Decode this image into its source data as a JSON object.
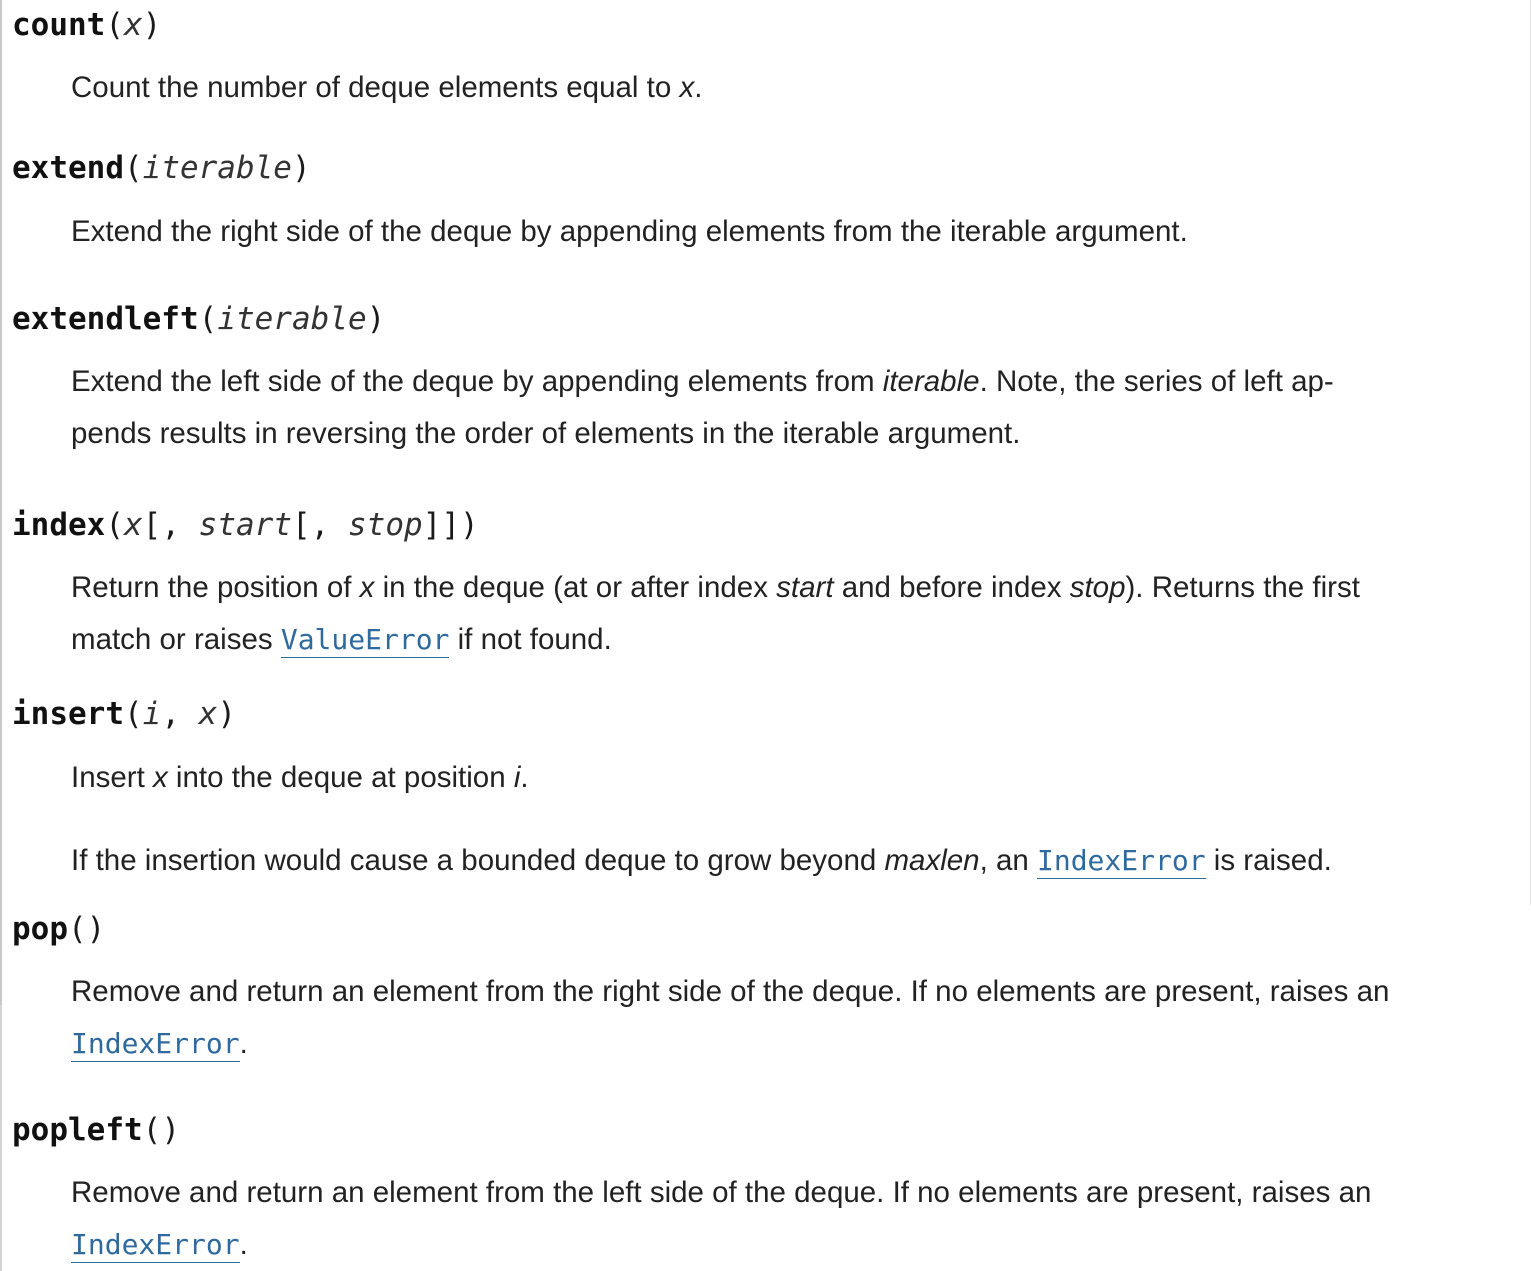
{
  "colors": {
    "text": "#222222",
    "link": "#2f6a9f",
    "rule": "#c8c8c8"
  },
  "methods": [
    {
      "name": "count",
      "sig": {
        "open": "(",
        "arg_x": "x",
        "close": ")"
      },
      "desc": {
        "pre": "Count the number of deque elements equal to ",
        "x": "x",
        "post": "."
      }
    },
    {
      "name": "extend",
      "sig": {
        "open": "(",
        "arg_iterable": "iterable",
        "close": ")"
      },
      "desc": {
        "text": "Extend the right side of the deque by appending elements from the iterable argument."
      }
    },
    {
      "name": "extendleft",
      "sig": {
        "open": "(",
        "arg_iterable": "iterable",
        "close": ")"
      },
      "desc": {
        "pre": "Extend the left side of the deque by appending elements from ",
        "iterable": "iterable",
        "mid": ". Note, the series of left ap-",
        "line2": "pends results in reversing the order of elements in the iterable argument."
      }
    },
    {
      "name": "index",
      "sig": {
        "open": "(",
        "arg_x": "x",
        "br1": "[, ",
        "arg_start": "start",
        "br2": "[, ",
        "arg_stop": "stop",
        "close": "]])"
      },
      "desc": {
        "pre": "Return the position of ",
        "x": "x",
        "mid1": " in the deque (at or after index ",
        "start": "start",
        "mid2": " and before index ",
        "stop": "stop",
        "mid3": "). Returns the first",
        "line2_pre": "match or raises ",
        "link": "ValueError",
        "line2_post": " if not found."
      }
    },
    {
      "name": "insert",
      "sig": {
        "open": "(",
        "arg_i": "i",
        "sep": ", ",
        "arg_x": "x",
        "close": ")"
      },
      "desc": {
        "pre": "Insert ",
        "x": "x",
        "mid": " into the deque at position ",
        "i": "i",
        "post": ".",
        "p2_pre": "If the insertion would cause a bounded deque to grow beyond ",
        "maxlen": "maxlen",
        "p2_mid": ", an ",
        "link": "IndexError",
        "p2_post": " is raised."
      }
    },
    {
      "name": "pop",
      "sig": {
        "parens": "()"
      },
      "desc": {
        "line1": "Remove and return an element from the right side of the deque. If no elements are present, raises an",
        "link": "IndexError",
        "post": "."
      }
    },
    {
      "name": "popleft",
      "sig": {
        "parens": "()"
      },
      "desc": {
        "line1": "Remove and return an element from the left side of the deque. If no elements are present, raises an",
        "link": "IndexError",
        "post": "."
      }
    }
  ]
}
